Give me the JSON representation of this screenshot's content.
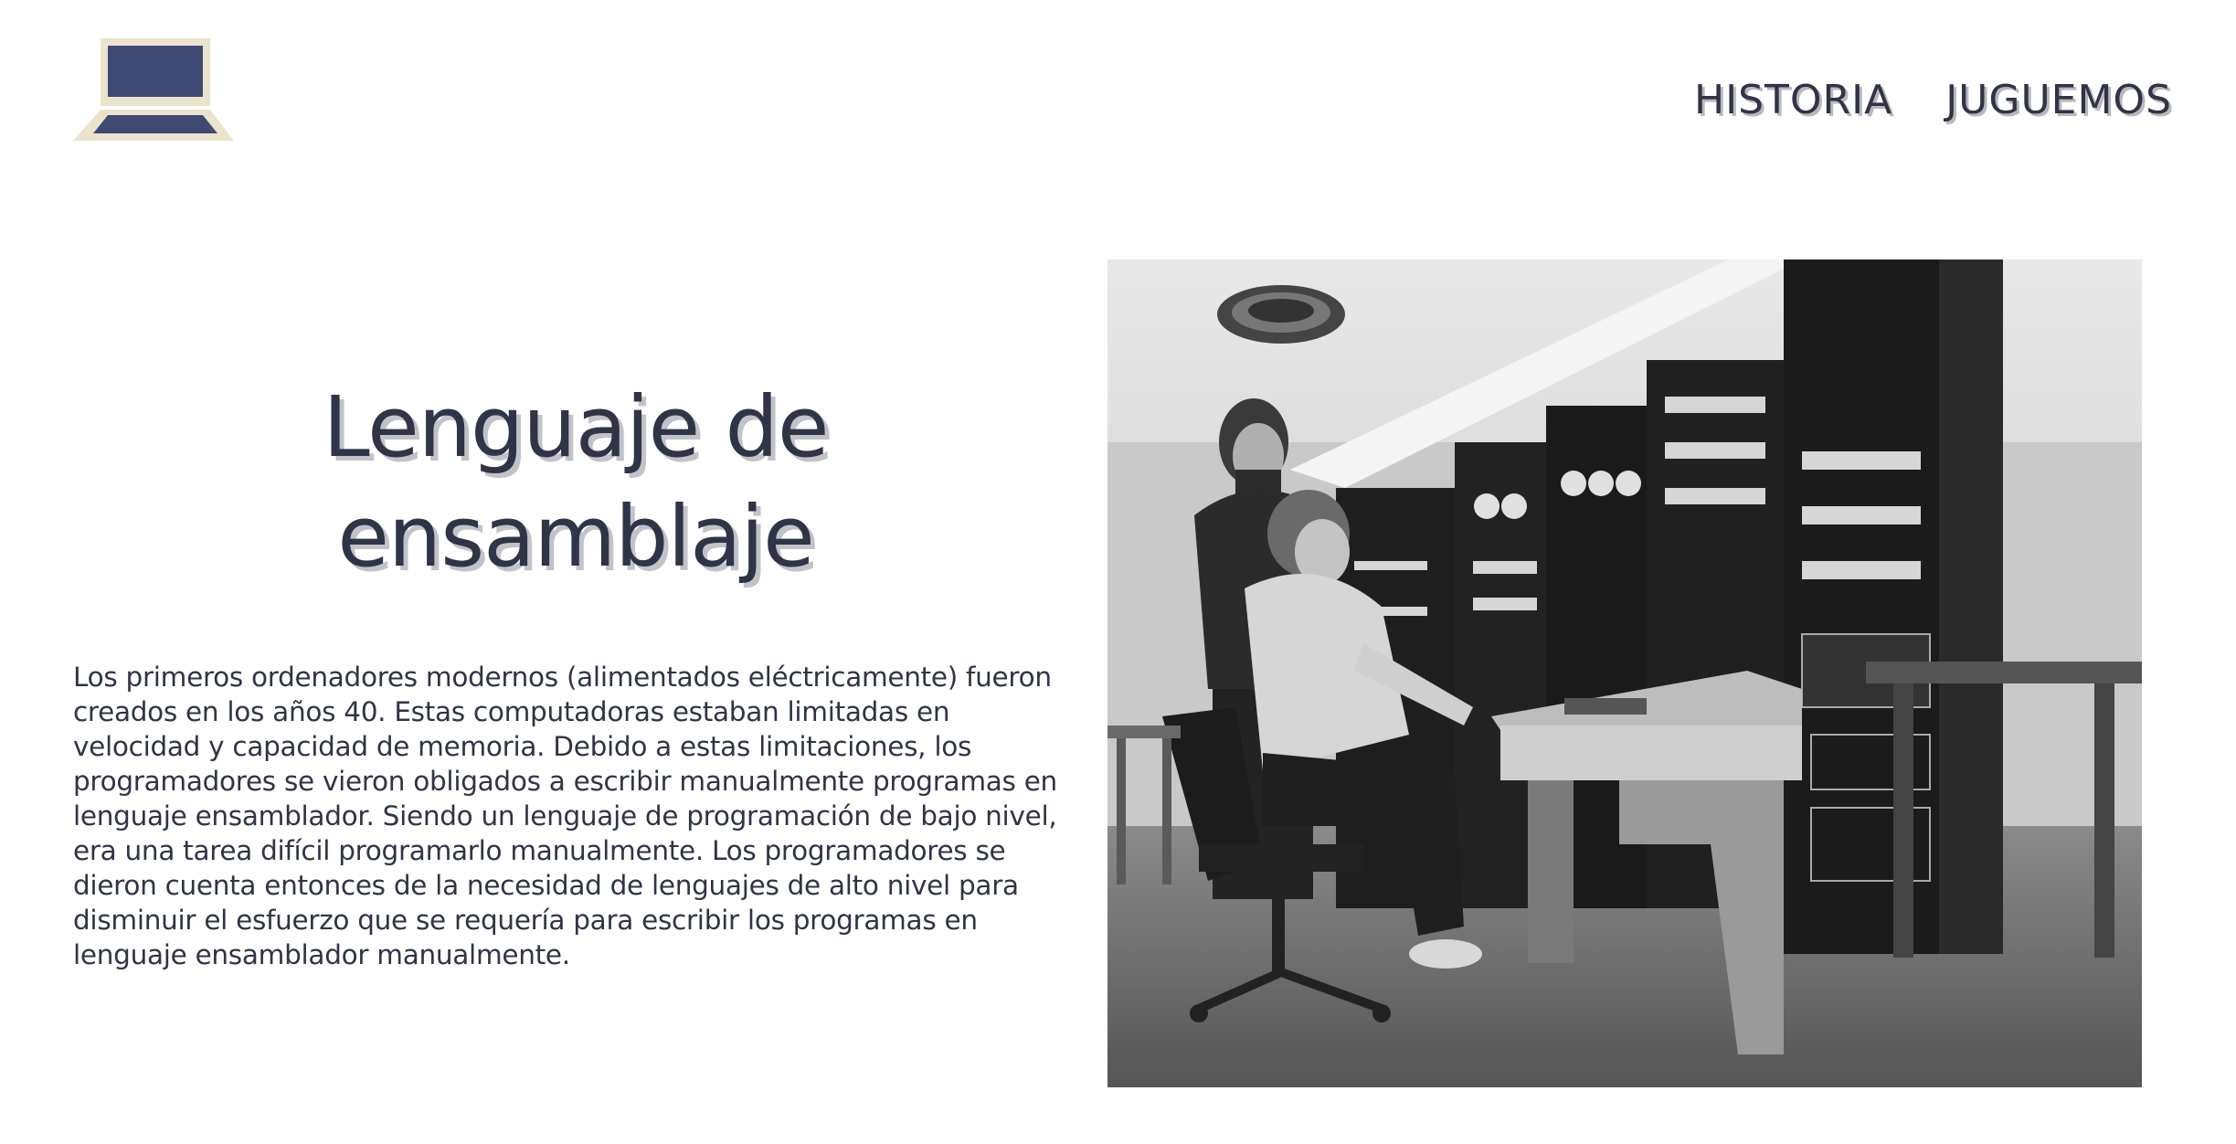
{
  "header": {
    "logo_icon": "computer-laptop-icon",
    "colors": {
      "logo_screen": "#3f4a73",
      "logo_frame": "#ebe3cc",
      "text": "#2f3446",
      "text_shadow": "#b8b8bf"
    },
    "nav": [
      {
        "label": "HISTORIA"
      },
      {
        "label": "JUGUEMOS"
      }
    ]
  },
  "hero": {
    "title": "Lenguaje de ensamblaje",
    "body": "Los primeros ordenadores modernos (alimentados eléctricamente) fueron creados en los años 40. Estas computadoras estaban limitadas en velocidad y capacidad de memoria. Debido a estas limitaciones, los programadores se vieron obligados a escribir manualmente programas en lenguaje ensamblador. Siendo un lenguaje de programación de bajo nivel, era una tarea difícil programarlo manualmente. Los programadores se dieron cuenta entonces de la necesidad de lenguajes de alto nivel para disminuir el esfuerzo que se requería para escribir los programas en lenguaje ensamblador manualmente."
  },
  "photo": {
    "icon": "historic-computer-photo-icon"
  }
}
